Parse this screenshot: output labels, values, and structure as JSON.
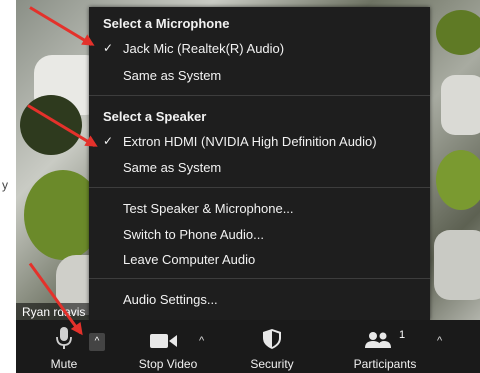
{
  "side_text": "y",
  "participant_name": "Ryan rdavis",
  "menu": {
    "mic_header": "Select a Microphone",
    "mic_items": [
      {
        "label": "Jack Mic (Realtek(R) Audio)",
        "checked": true
      },
      {
        "label": "Same as System",
        "checked": false
      }
    ],
    "speaker_header": "Select a Speaker",
    "speaker_items": [
      {
        "label": "Extron HDMI (NVIDIA High Definition Audio)",
        "checked": true
      },
      {
        "label": "Same as System",
        "checked": false
      }
    ],
    "actions": [
      "Test Speaker & Microphone...",
      "Switch to Phone Audio...",
      "Leave Computer Audio"
    ],
    "settings": "Audio Settings...",
    "check_glyph": "✓"
  },
  "toolbar": {
    "mute": "Mute",
    "stop_video": "Stop Video",
    "security": "Security",
    "participants": "Participants",
    "participants_count": "1"
  },
  "colors": {
    "menu_bg": "#1e1e1e",
    "toolbar_bg": "#1a1a1a",
    "arrow": "#e4312b"
  }
}
